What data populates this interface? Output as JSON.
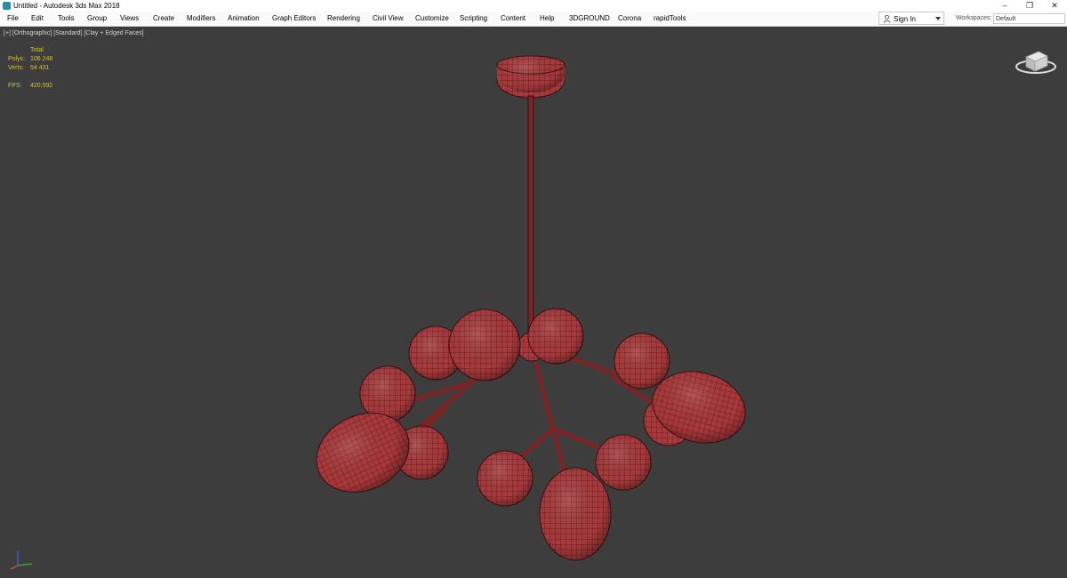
{
  "window": {
    "title": "Untitled - Autodesk 3ds Max 2018",
    "minimize": "–",
    "restore": "❐",
    "close": "✕"
  },
  "menu": [
    "File",
    "Edit",
    "Tools",
    "Group",
    "Views",
    "Create",
    "Modifiers",
    "Animation",
    "Graph Editors",
    "Rendering",
    "Civil View",
    "Customize",
    "Scripting",
    "Content",
    "Help",
    "3DGROUND",
    "Corona",
    "rapidTools"
  ],
  "signin": {
    "label": "Sign In"
  },
  "workspaces": {
    "label": "Workspaces:",
    "value": "Default"
  },
  "viewport": {
    "label": "[+] [Orthographic] [Standard] [Clay + Edged Faces]",
    "stats": {
      "header": "Total",
      "polys_label": "Polys:",
      "polys_value": "106 248",
      "verts_label": "Verts:",
      "verts_value": "54 431",
      "fps_label": "FPS:",
      "fps_value": "420,592"
    }
  },
  "colors": {
    "viewport_bg": "#3d3d3d",
    "clay": "#a8383a",
    "stats_text": "#d8c22a"
  }
}
